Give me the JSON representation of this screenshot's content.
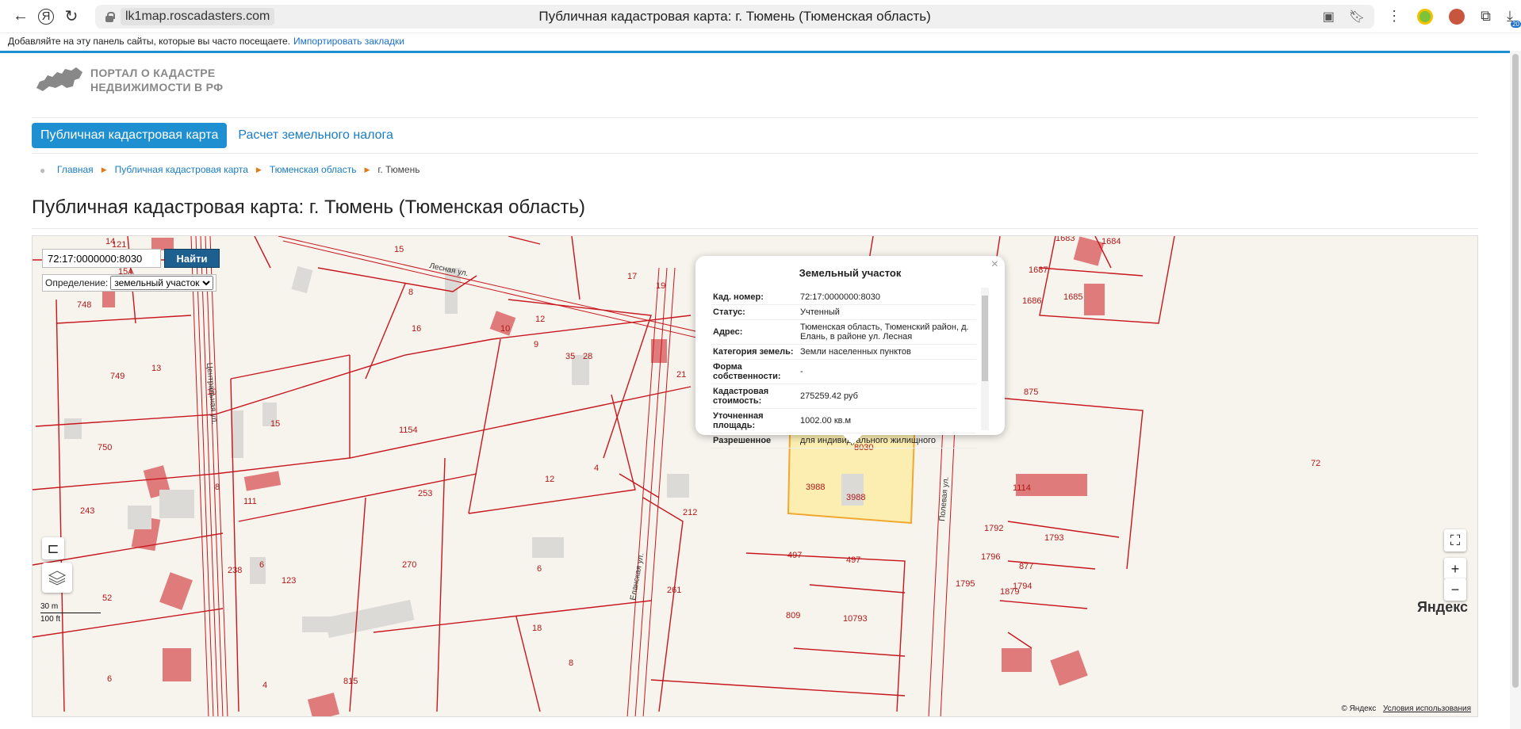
{
  "browser": {
    "url_host": "lk1map.roscadasters.com",
    "tab_title": "Публичная кадастровая карта: г. Тюмень (Тюменская область)",
    "bookmarks_text": "Добавляйте на эту панель сайты, которые вы часто посещаете.",
    "bookmarks_link": "Импортировать закладки",
    "downloads_badge": "20"
  },
  "site": {
    "logo_line1": "ПОРТАЛ О КАДАСТРЕ",
    "logo_line2": "НЕДВИЖИМОСТИ В РФ",
    "nav": {
      "active": "Публичная кадастровая карта",
      "link": "Расчет земельного налога"
    },
    "breadcrumbs": [
      "Главная",
      "Публичная кадастровая карта",
      "Тюменская область",
      "г. Тюмень"
    ],
    "title": "Публичная кадастровая карта: г. Тюмень (Тюменская область)"
  },
  "map": {
    "search_value": "72:17:0000000:8030",
    "search_button": "Найти",
    "definition_label": "Определение:",
    "definition_value": "земельный участок",
    "scale_m": "30 m",
    "scale_ft": "100 ft",
    "logo": "Яндекс",
    "copyright": "© Яндекс",
    "terms": "Условия использования",
    "streets": [
      "Лесная ул.",
      "Еланская ул.",
      "Полевая ул.",
      "Центральная ул."
    ],
    "popup": {
      "title": "Земельный участок",
      "rows": [
        {
          "k": "Кад. номер:",
          "v": "72:17:0000000:8030"
        },
        {
          "k": "Статус:",
          "v": "Учтенный"
        },
        {
          "k": "Адрес:",
          "v": "Тюменская область, Тюменский район, д. Елань, в районе ул. Лесная"
        },
        {
          "k": "Категория земель:",
          "v": "Земли населенных пунктов"
        },
        {
          "k": "Форма собственности:",
          "v": "-"
        },
        {
          "k": "Кадастровая стоимость:",
          "v": "275259.42 руб"
        },
        {
          "k": "Уточненная площадь:",
          "v": "1002.00 кв.м"
        },
        {
          "k": "Разрешенное",
          "v": "для индивидуального жилищного"
        }
      ]
    }
  },
  "colors": {
    "accent": "#1e8fd0",
    "parcel_line": "#c8161d",
    "building": "#e07b7b",
    "selected_parcel": "#fbeeb0"
  }
}
